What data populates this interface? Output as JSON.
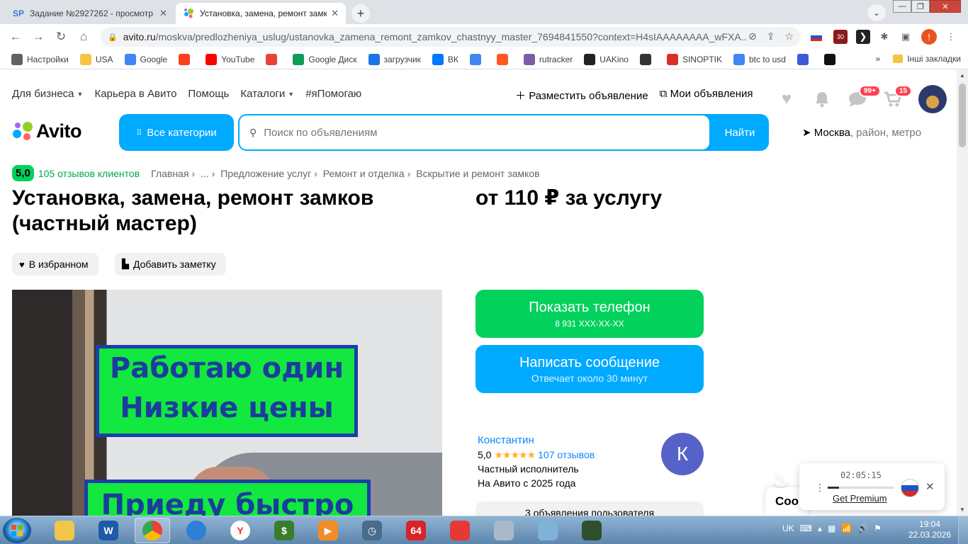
{
  "browser": {
    "tabs": [
      {
        "label": "Задание №2927262 - просмотр",
        "favicon": "SP",
        "active": false
      },
      {
        "label": "Установка, замена, ремонт замков",
        "favicon": "avito-dots",
        "active": true
      }
    ],
    "new_tab": "+",
    "tab_dropdown": "⌄",
    "window": {
      "minimize": "—",
      "maximize": "❐",
      "close": "✕"
    },
    "url_main": "avito.ru",
    "url_path": "/moskva/predlozheniya_uslug/ustanovka_zamena_remont_zamkov_chastnyy_master_7694841550?context=H4sIAAAAAAAA_wFXA...",
    "extension_badge": "30",
    "profile_initial": "!",
    "bookmarks": [
      {
        "label": "Настройки",
        "icon": "gear-icon",
        "color": "#5f6368"
      },
      {
        "label": "USA",
        "icon": "folder-icon",
        "color": "#f4c542"
      },
      {
        "label": "Google",
        "icon": "google-icon",
        "color": "#4285f4"
      },
      {
        "label": "",
        "icon": "yandex-icon",
        "color": "#fc3f1d"
      },
      {
        "label": "YouTube",
        "icon": "youtube-icon",
        "color": "#ff0000"
      },
      {
        "label": "",
        "icon": "gmail-icon",
        "color": "#ea4335"
      },
      {
        "label": "Google Диск",
        "icon": "drive-icon",
        "color": "#0f9d58"
      },
      {
        "label": "загрузчик",
        "icon": "infinity-icon",
        "color": "#1a73e8"
      },
      {
        "label": "ВК",
        "icon": "vk-icon",
        "color": "#0077ff"
      },
      {
        "label": "",
        "icon": "translate-icon",
        "color": "#4285f4"
      },
      {
        "label": "",
        "icon": "f-icon",
        "color": "#ff5722"
      },
      {
        "label": "rutracker",
        "icon": "rutracker-icon",
        "color": "#7b5ea7"
      },
      {
        "label": "UAKino",
        "icon": "uakino-icon",
        "color": "#222222"
      },
      {
        "label": "",
        "icon": "chess-icon",
        "color": "#333333"
      },
      {
        "label": "SINOPTIK",
        "icon": "thermometer-icon",
        "color": "#d93025"
      },
      {
        "label": "btc to usd",
        "icon": "google-icon",
        "color": "#4285f4"
      },
      {
        "label": "",
        "icon": "arrow-icon",
        "color": "#3b5bdb"
      },
      {
        "label": "",
        "icon": "bc-icon",
        "color": "#111111"
      }
    ],
    "bookmarks_more": "»",
    "other_bookmarks": "Інші закладки"
  },
  "avito": {
    "nav_left": [
      {
        "label": "Для бизнеса",
        "dropdown": true
      },
      {
        "label": "Карьера в Авито",
        "dropdown": false
      },
      {
        "label": "Помощь",
        "dropdown": false
      },
      {
        "label": "Каталоги",
        "dropdown": true
      },
      {
        "label": "#яПомогаю",
        "dropdown": false
      }
    ],
    "post_ad": "Разместить объявление",
    "my_ads": "Мои объявления",
    "messages_badge": "99+",
    "cart_badge": "15",
    "logo_text": "Avito",
    "all_categories": "Все категории",
    "search_placeholder": "Поиск по объявлениям",
    "search_button": "Найти",
    "location_city": "Москва",
    "location_rest": ", район, метро",
    "rating": "5,0",
    "reviews": "105 отзывов клиентов",
    "breadcrumbs": [
      "Главная",
      "...",
      "Предложение услуг",
      "Ремонт и отделка",
      "Вскрытие и ремонт замков"
    ],
    "title": "Установка, замена, ремонт замков (частный мастер)",
    "price": "от 110 ₽ за услугу",
    "favorite_label": "В избранном",
    "note_label": "Добавить заметку",
    "photo_sign_1": "Работаю один Низкие цены",
    "photo_sign_2": "Приеду быстро",
    "show_phone": "Показать телефон",
    "phone_masked": "8 931 XXX-XX-XX",
    "write_message": "Написать сообщение",
    "reply_time": "Отвечает около 30 минут",
    "seller": {
      "name": "Константин",
      "rating": "5,0",
      "stars": "★★★★★",
      "reviews": "107 отзывов",
      "type": "Частный исполнитель",
      "since": "На Авито с 2025 года",
      "initial": "К"
    },
    "more_ads": "3 объявления пользователя",
    "cookie_peek": "Coo"
  },
  "recorder": {
    "time": "02:05:15",
    "progress": 0.17,
    "premium": "Get Premium",
    "close": "✕"
  },
  "taskbar": {
    "apps": [
      {
        "name": "explorer",
        "label": "",
        "color": "#f3c64a"
      },
      {
        "name": "shield-app",
        "label": "W",
        "color": "#1d5ba8"
      },
      {
        "name": "chrome",
        "label": "",
        "color": "#34a853",
        "active": true
      },
      {
        "name": "globe-app",
        "label": "",
        "color": "#2e7fd6"
      },
      {
        "name": "yandex-browser",
        "label": "Y",
        "color": "#ffffff"
      },
      {
        "name": "money-app",
        "label": "$",
        "color": "#3a7d2c"
      },
      {
        "name": "media-player",
        "label": "▶",
        "color": "#f28c28"
      },
      {
        "name": "clock-app",
        "label": "◷",
        "color": "#4a6b8a"
      },
      {
        "name": "aida64",
        "label": "64",
        "color": "#d8232a"
      },
      {
        "name": "chart-app",
        "label": "",
        "color": "#e53935"
      },
      {
        "name": "calculator",
        "label": "",
        "color": "#a9b9c9"
      },
      {
        "name": "notes-app",
        "label": "",
        "color": "#7fb2d9"
      },
      {
        "name": "monitor-app",
        "label": "",
        "color": "#2f4f2f"
      }
    ],
    "lang": "UK",
    "time": "19:04",
    "date": "22.03.2026"
  }
}
